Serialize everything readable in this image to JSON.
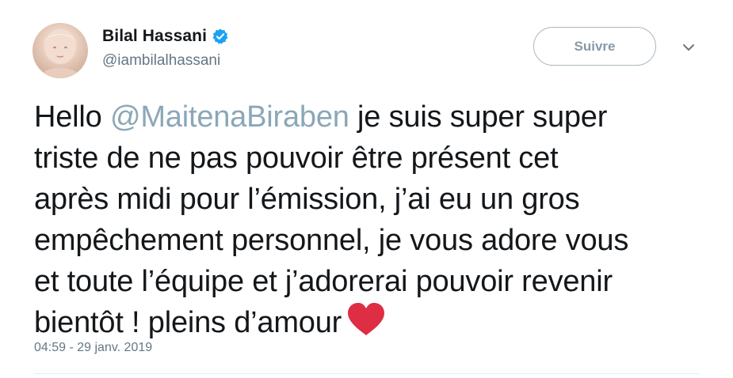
{
  "author": {
    "display_name": "Bilal Hassani",
    "handle": "@iambilalhassani",
    "verified_icon": "verified-badge-icon",
    "avatar_icon": "avatar"
  },
  "actions": {
    "follow_label": "Suivre",
    "menu_icon": "chevron-down-icon"
  },
  "tweet": {
    "lines": [
      {
        "pre": "Hello ",
        "mention": "@MaitenaBiraben",
        "post": " je suis super super"
      },
      {
        "text": "triste de ne pas pouvoir être présent cet"
      },
      {
        "text": "après midi pour l’émission, j’ai eu un gros"
      },
      {
        "text": "empêchement personnel, je vous adore vous"
      },
      {
        "text": "et toute l’équipe et j’adorerai pouvoir revenir"
      },
      {
        "text": "bientôt ! pleins d’amour"
      }
    ],
    "emoji": "red-heart-icon",
    "timestamp": "04:59 - 29 janv. 2019"
  },
  "colors": {
    "text": "#14171a",
    "secondary": "#657786",
    "mention": "#8ba7b8",
    "verified": "#1da1f2",
    "heart": "#dd2e44",
    "button_border": "#aab8c2"
  }
}
